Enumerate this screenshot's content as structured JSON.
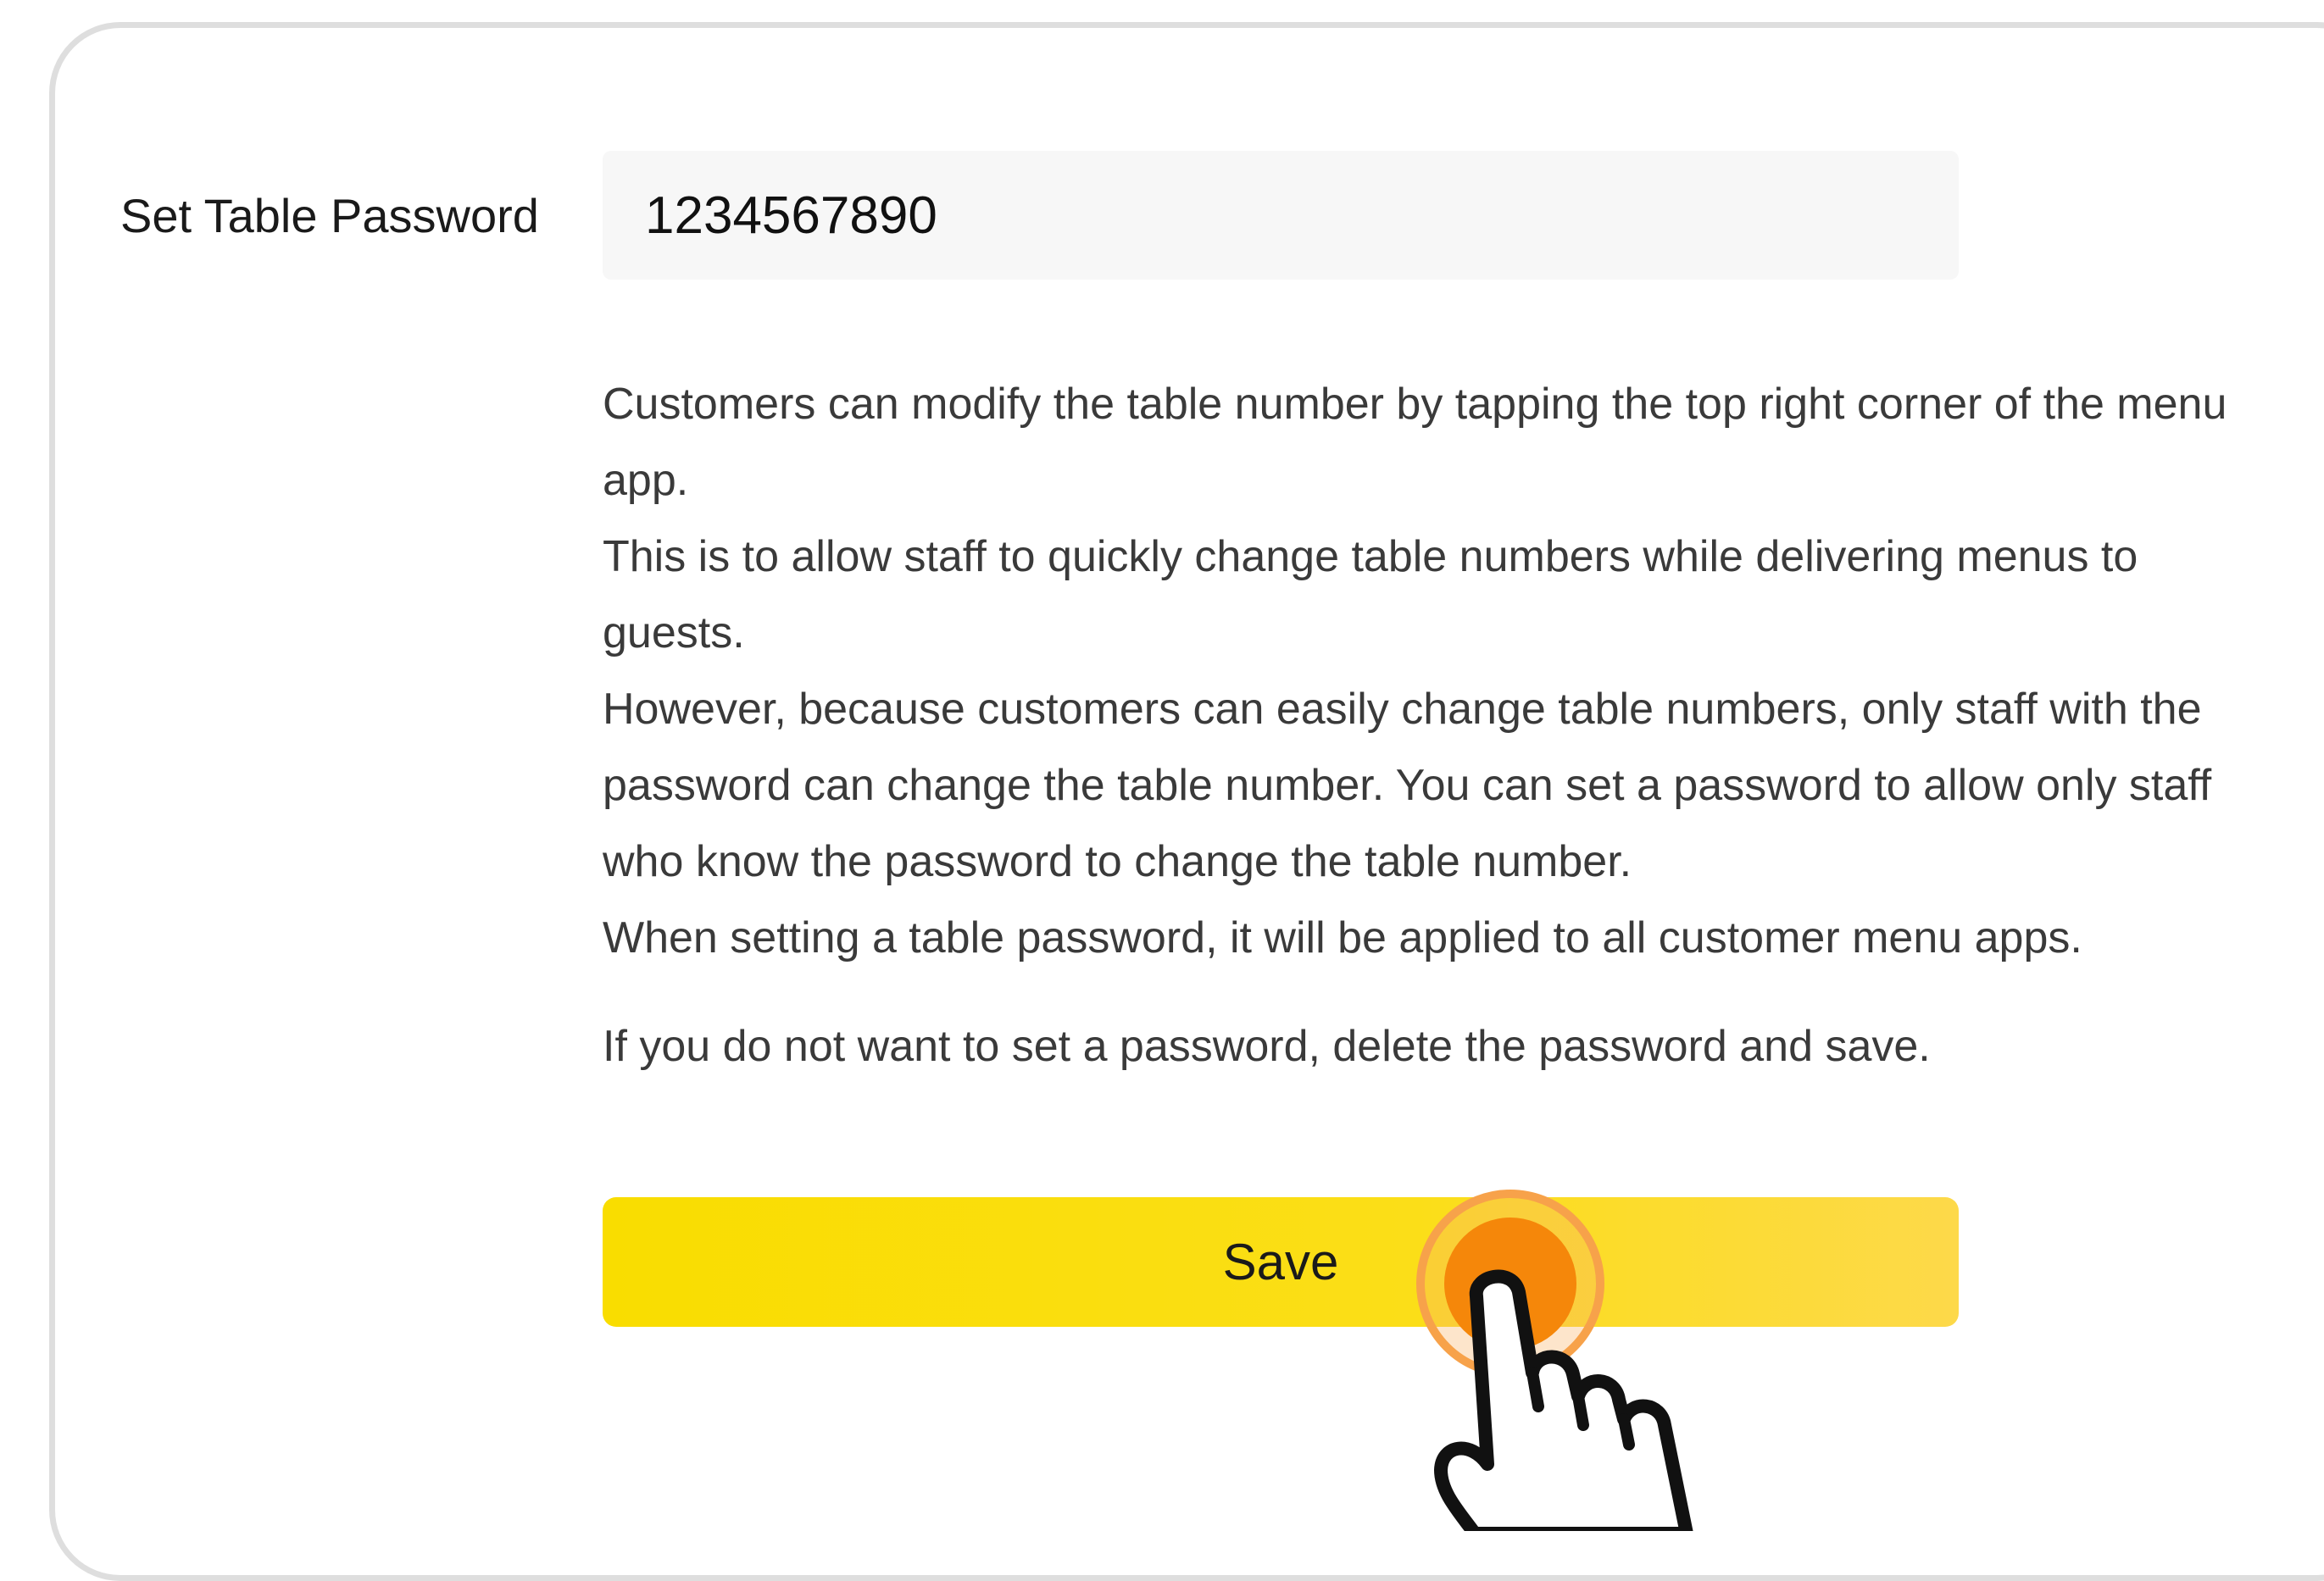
{
  "form": {
    "password_label": "Set Table Password",
    "password_value": "1234567890"
  },
  "help": {
    "line1": "Customers can modify the table number by tapping the top right corner of the menu app.",
    "line2": "This is to allow staff to quickly change table numbers while delivering menus to guests.",
    "line3": "However, because customers can easily change table numbers, only staff with the password can change the table number. You can set a password to allow only staff who know the password to change the table number.",
    "line4": "When setting a table password, it will be applied to all customer menu apps.",
    "line5": "If you do not want to set a password, delete the password and save."
  },
  "actions": {
    "save_label": "Save"
  },
  "indicator": {
    "icon": "tap-hand-icon",
    "ring_color": "#f7a24a",
    "dot_color": "#f5870a"
  },
  "colors": {
    "save_button": "#fade0f",
    "input_background": "#f7f7f7",
    "frame_border": "#dedede"
  }
}
